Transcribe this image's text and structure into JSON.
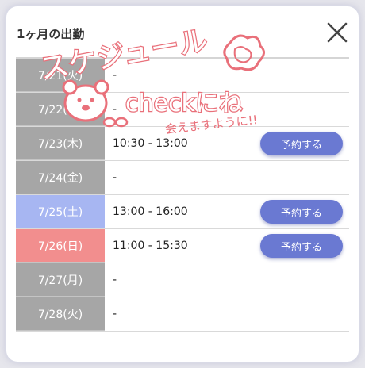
{
  "header": {
    "title": "1ヶ月の出勤",
    "close_icon": "close-icon"
  },
  "schedule": [
    {
      "date": "7/21(火)",
      "time": "-",
      "day_type": "weekday",
      "book_label": ""
    },
    {
      "date": "7/22(水)",
      "time": "-",
      "day_type": "weekday",
      "book_label": ""
    },
    {
      "date": "7/23(木)",
      "time": "10:30 - 13:00",
      "day_type": "weekday",
      "book_label": "予約する"
    },
    {
      "date": "7/24(金)",
      "time": "-",
      "day_type": "weekday",
      "book_label": ""
    },
    {
      "date": "7/25(土)",
      "time": "13:00 - 16:00",
      "day_type": "saturday",
      "book_label": "予約する"
    },
    {
      "date": "7/26(日)",
      "time": "11:00 - 15:30",
      "day_type": "sunday",
      "book_label": "予約する"
    },
    {
      "date": "7/27(月)",
      "time": "-",
      "day_type": "weekday",
      "book_label": ""
    },
    {
      "date": "7/28(火)",
      "time": "-",
      "day_type": "weekday",
      "book_label": ""
    }
  ],
  "stamp": {
    "main": "スケジュール",
    "check": "checkにね",
    "sub": "会えますように!!"
  },
  "colors": {
    "weekday": "#a6a6a6",
    "saturday": "#a7b6f2",
    "sunday": "#f28e8e",
    "button": "#6a79d2",
    "stamp": "#e9707a"
  }
}
